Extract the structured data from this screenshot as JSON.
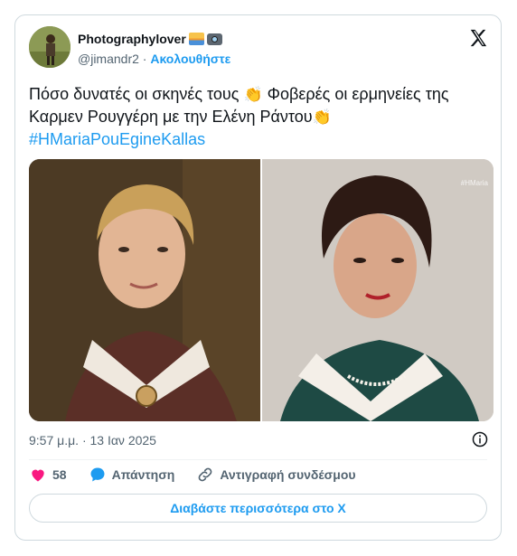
{
  "author": {
    "display_name": "Photographylover",
    "handle": "@jimandr2",
    "separator": "·",
    "follow_label": "Ακολουθήστε"
  },
  "tweet": {
    "text_part1": "Πόσο δυνατές οι σκηνές τους",
    "text_part2": "Φοβερές οι ερμηνείες της Καρμεν Ρουγγέρη με την Ελένη Ράντου",
    "hashtag": "#HMariaPouEgineKallas",
    "timestamp": "9:57 μ.μ. · 13 Ιαν 2025",
    "watermark": "#HMaria"
  },
  "actions": {
    "like_count": "58",
    "reply_label": "Απάντηση",
    "copy_link_label": "Αντιγραφή συνδέσμου"
  },
  "read_more_label": "Διαβάστε περισσότερα στο X",
  "icons": {
    "like": "heart-icon",
    "reply": "speech-bubble-icon",
    "copy": "link-icon",
    "info": "info-icon",
    "brand": "x-logo-icon"
  },
  "colors": {
    "accent": "#1d9bf0",
    "like": "#f91880",
    "muted": "#536471",
    "border": "#cfd9de"
  }
}
